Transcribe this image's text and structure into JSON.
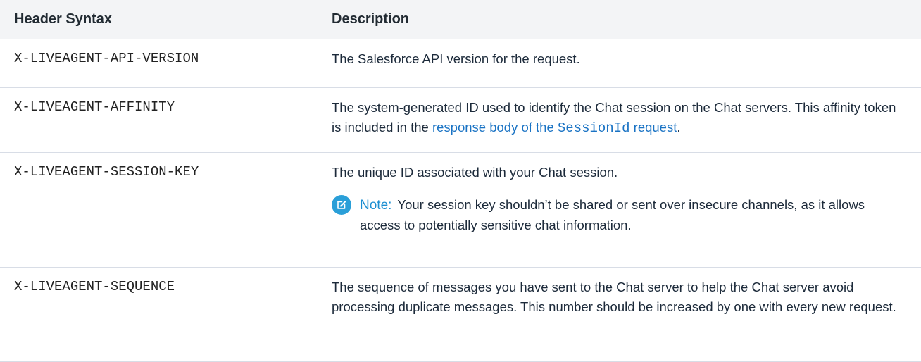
{
  "table": {
    "headers": {
      "syntax": "Header Syntax",
      "description": "Description"
    },
    "rows": [
      {
        "syntax": "X-LIVEAGENT-API-VERSION",
        "description": "The Salesforce API version for the request."
      },
      {
        "syntax": "X-LIVEAGENT-AFFINITY",
        "description_before_link": "The system-generated ID used to identify the Chat session on the Chat servers. This affinity token is included in the ",
        "link_text_before_code": "response body of the ",
        "link_code": "SessionId",
        "link_text_after_code": " request",
        "description_after_link": "."
      },
      {
        "syntax": "X-LIVEAGENT-SESSION-KEY",
        "description": "The unique ID associated with your Chat session.",
        "note_label": "Note:",
        "note_text": "Your session key shouldn’t be shared or sent over insecure channels, as it allows access to potentially sensitive chat information.",
        "note_icon": "edit-note-icon"
      },
      {
        "syntax": "X-LIVEAGENT-SEQUENCE",
        "description": "The sequence of messages you have sent to the Chat server to help the Chat server avoid processing duplicate messages. This number should be increased by one with every new request."
      }
    ]
  },
  "colors": {
    "link": "#1a73c4",
    "note_accent": "#2a9fd8",
    "header_bg": "#f3f4f6"
  }
}
